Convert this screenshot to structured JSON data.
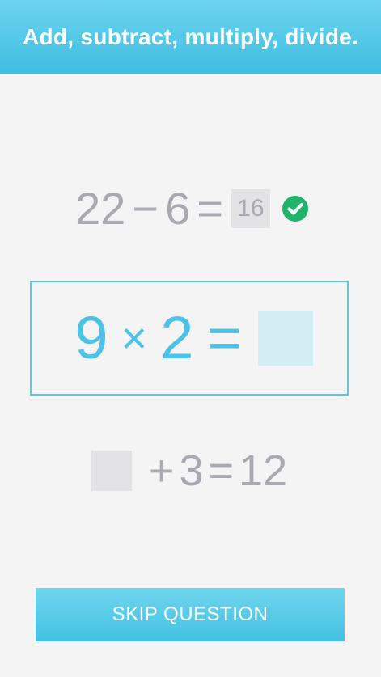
{
  "header": {
    "title": "Add, subtract, multiply, divide."
  },
  "solved_equation": {
    "left": "22",
    "operator": "−",
    "right": "6",
    "equals": "=",
    "answer": "16",
    "status_icon": "check-circle-icon",
    "status_color": "#1fb46a"
  },
  "active_equation": {
    "left": "9",
    "operator": "×",
    "right": "2",
    "equals": "=",
    "answer_value": "",
    "accent_color": "#4cc2e6"
  },
  "next_equation": {
    "blank": "",
    "operator": "+",
    "right": "3",
    "equals": "=",
    "result": "12"
  },
  "skip_button": {
    "label": "SKIP QUESTION"
  }
}
